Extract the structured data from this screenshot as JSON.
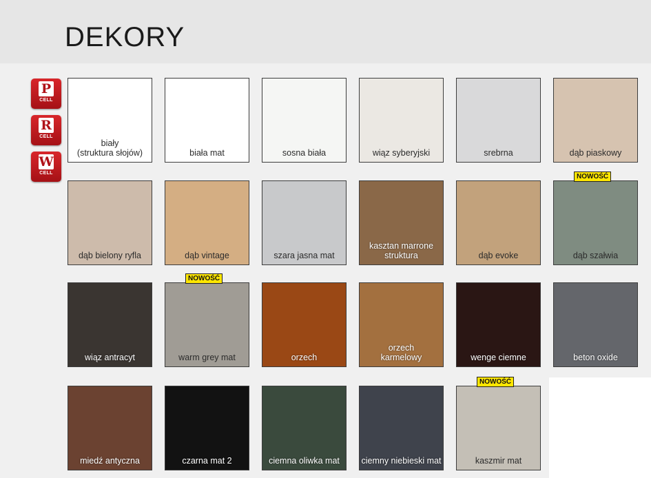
{
  "page": {
    "title": "DEKORY"
  },
  "badges": [
    {
      "letter": "P",
      "sub": "CELL"
    },
    {
      "letter": "R",
      "sub": "CELL"
    },
    {
      "letter": "W",
      "sub": "CELL"
    }
  ],
  "new_tag": "NOWOŚĆ",
  "swatches": [
    {
      "label": "biały\n(struktura słojów)",
      "bg": "#ffffff",
      "text": "dark"
    },
    {
      "label": "biała mat",
      "bg": "#ffffff",
      "text": "dark"
    },
    {
      "label": "sosna biała",
      "bg": "#f5f6f4",
      "text": "dark"
    },
    {
      "label": "wiąz syberyjski",
      "bg": "#ebe8e3",
      "text": "dark"
    },
    {
      "label": "srebrna",
      "bg": "#d9d9da",
      "text": "dark"
    },
    {
      "label": "dąb piaskowy",
      "bg": "#d6c3b0",
      "text": "dark"
    },
    {
      "label": "dąb bielony ryfla",
      "bg": "#cdbbab",
      "text": "dark"
    },
    {
      "label": "dąb vintage",
      "bg": "#d4ae83",
      "text": "dark"
    },
    {
      "label": "szara jasna mat",
      "bg": "#c8c9cb",
      "text": "dark"
    },
    {
      "label": "kasztan marrone\nstruktura",
      "bg": "#8a6848",
      "text": "light"
    },
    {
      "label": "dąb evoke",
      "bg": "#c2a27c",
      "text": "dark"
    },
    {
      "label": "dąb szałwia",
      "bg": "#7f8c81",
      "text": "dark",
      "new": true
    },
    {
      "label": "wiąz antracyt",
      "bg": "#3a3531",
      "text": "light"
    },
    {
      "label": "warm grey mat",
      "bg": "#a09c95",
      "text": "dark",
      "new": true
    },
    {
      "label": "orzech",
      "bg": "#9a4815",
      "text": "light"
    },
    {
      "label": "orzech\nkarmelowy",
      "bg": "#a3703f",
      "text": "light"
    },
    {
      "label": "wenge ciemne",
      "bg": "#2a1614",
      "text": "light"
    },
    {
      "label": "beton oxide",
      "bg": "#64666b",
      "text": "light"
    },
    {
      "label": "miedź antyczna",
      "bg": "#6b4231",
      "text": "light"
    },
    {
      "label": "czarna mat 2",
      "bg": "#121212",
      "text": "light"
    },
    {
      "label": "ciemna oliwka mat",
      "bg": "#3a4a3d",
      "text": "light"
    },
    {
      "label": "ciemny niebieski mat",
      "bg": "#3f434c",
      "text": "light"
    },
    {
      "label": "kaszmir mat",
      "bg": "#c4bfb6",
      "text": "dark",
      "new": true
    }
  ]
}
